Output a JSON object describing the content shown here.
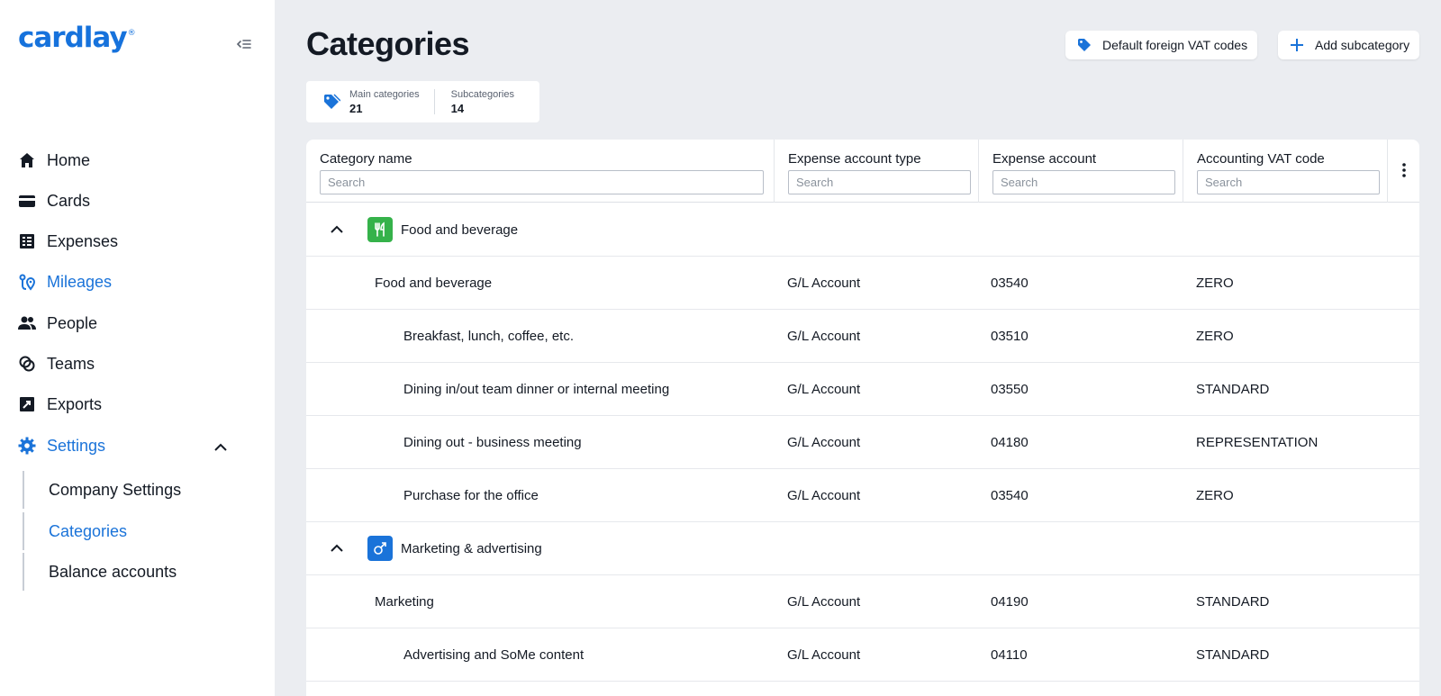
{
  "app": {
    "logo": "cardlay",
    "logo_mark": "®"
  },
  "colors": {
    "accent": "#1a73d9",
    "food_icon_bg": "#35b24a",
    "marketing_icon_bg": "#1a73d9"
  },
  "sidebar": {
    "items": [
      {
        "label": "Home",
        "icon": "home-icon"
      },
      {
        "label": "Cards",
        "icon": "card-icon"
      },
      {
        "label": "Expenses",
        "icon": "receipt-icon"
      },
      {
        "label": "Mileages",
        "icon": "route-icon",
        "active": true
      },
      {
        "label": "People",
        "icon": "people-icon"
      },
      {
        "label": "Teams",
        "icon": "teams-icon"
      },
      {
        "label": "Exports",
        "icon": "export-icon"
      },
      {
        "label": "Settings",
        "icon": "gear-icon",
        "active": true,
        "expanded": true
      }
    ],
    "settings_sub": [
      {
        "label": "Company Settings"
      },
      {
        "label": "Categories",
        "active": true
      },
      {
        "label": "Balance accounts"
      }
    ]
  },
  "header": {
    "title": "Categories",
    "vat_button": "Default foreign VAT codes",
    "add_button": "Add subcategory"
  },
  "stats": {
    "main_label": "Main categories",
    "main_value": "21",
    "sub_label": "Subcategories",
    "sub_value": "14"
  },
  "table": {
    "columns": [
      {
        "label": "Category name",
        "placeholder": "Search"
      },
      {
        "label": "Expense account type",
        "placeholder": "Search"
      },
      {
        "label": "Expense account",
        "placeholder": "Search"
      },
      {
        "label": "Accounting VAT code",
        "placeholder": "Search"
      }
    ],
    "groups": [
      {
        "name": "Food and beverage",
        "icon": "fork-knife-icon",
        "rows": [
          {
            "name": "Food and beverage",
            "type": "G/L Account",
            "account": "03540",
            "vat": "ZERO",
            "level": 1
          },
          {
            "name": "Breakfast, lunch, coffee, etc.",
            "type": "G/L Account",
            "account": "03510",
            "vat": "ZERO",
            "level": 2
          },
          {
            "name": "Dining in/out team dinner or internal meeting",
            "type": "G/L Account",
            "account": "03550",
            "vat": "STANDARD",
            "level": 2
          },
          {
            "name": "Dining out - business meeting",
            "type": "G/L Account",
            "account": "04180",
            "vat": "REPRESENTATION",
            "level": 2
          },
          {
            "name": "Purchase for the office",
            "type": "G/L Account",
            "account": "03540",
            "vat": "ZERO",
            "level": 2
          }
        ]
      },
      {
        "name": "Marketing & advertising",
        "icon": "megaphone-icon",
        "rows": [
          {
            "name": "Marketing",
            "type": "G/L Account",
            "account": "04190",
            "vat": "STANDARD",
            "level": 1
          },
          {
            "name": "Advertising and SoMe content",
            "type": "G/L Account",
            "account": "04110",
            "vat": "STANDARD",
            "level": 2
          }
        ]
      }
    ]
  }
}
